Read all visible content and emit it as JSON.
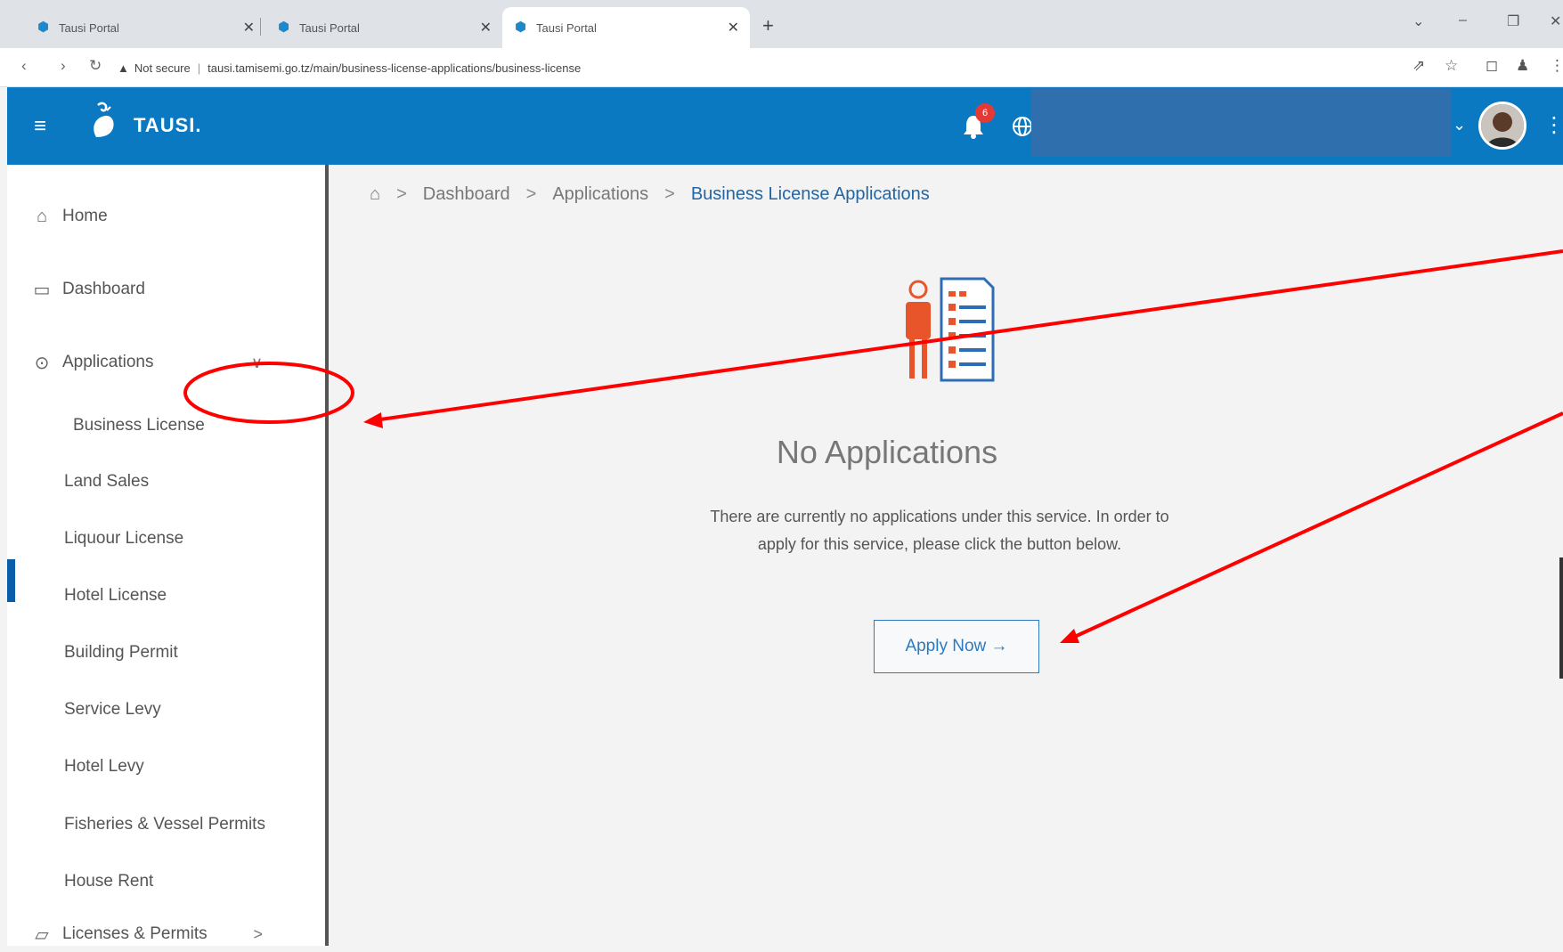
{
  "browser": {
    "tabs": [
      {
        "title": "Tausi Portal"
      },
      {
        "title": "Tausi Portal"
      },
      {
        "title": "Tausi Portal"
      }
    ],
    "new_tab": "+",
    "address": {
      "security": "Not secure",
      "url": "tausi.tamisemi.go.tz/main/business-license-applications/business-license"
    }
  },
  "app": {
    "brand": "TAUSI.",
    "notification_count": "6"
  },
  "sidebar": {
    "items": [
      {
        "label": "Home",
        "icon": "home-icon"
      },
      {
        "label": "Dashboard",
        "icon": "briefcase-icon"
      },
      {
        "label": "Applications",
        "icon": "applications-icon",
        "chevron": "∨"
      }
    ],
    "sub_items": [
      {
        "label": "Business License"
      },
      {
        "label": "Land Sales"
      },
      {
        "label": "Liquour License"
      },
      {
        "label": "Hotel License"
      },
      {
        "label": "Building Permit"
      },
      {
        "label": "Service Levy"
      },
      {
        "label": "Hotel Levy"
      },
      {
        "label": "Fisheries & Vessel Permits"
      },
      {
        "label": "House Rent"
      }
    ],
    "bottom_item": {
      "label": "Licenses & Permits",
      "icon": "folder-icon",
      "chevron": ">"
    }
  },
  "breadcrumb": {
    "items": [
      "Dashboard",
      "Applications",
      "Business License Applications"
    ],
    "separator": ">"
  },
  "empty_state": {
    "title": "No Applications",
    "description": "There are currently no applications under this service. In order to apply for this service, please click the button below.",
    "button_label": "Apply Now →"
  },
  "colors": {
    "app_bar": "#0a79c1",
    "accent": "#2d79bf",
    "annotation": "#ff0000"
  }
}
